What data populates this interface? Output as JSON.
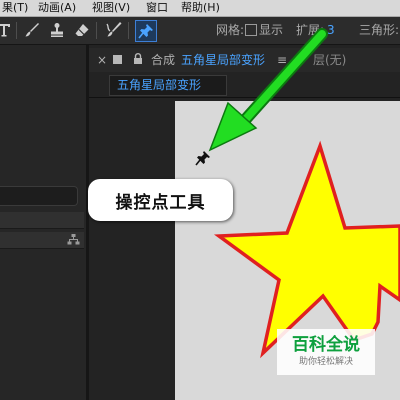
{
  "menubar": {
    "items": [
      "果(T)",
      "动画(A)",
      "视图(V)",
      "窗口",
      "帮助(H)"
    ]
  },
  "toolbar": {
    "tools": [
      "type-tool-icon",
      "brush-tool-icon",
      "clone-stamp-tool-icon",
      "eraser-tool-icon",
      "roto-brush-tool-icon",
      "puppet-pin-tool-icon"
    ],
    "selected_tool": "puppet-pin-tool-icon",
    "grid_label": "网格:",
    "show_label": "显示",
    "expand_label": "扩展:",
    "expand_value": "3",
    "triangles_label": "三角形:"
  },
  "composition_panel": {
    "close_glyph": "×",
    "panel_label": "合成",
    "comp_name": "五角星局部变形",
    "menu_glyph": "≡",
    "layer_label": "层(无)",
    "subtab_label": "五角星局部变形"
  },
  "annotation": {
    "callout_text": "操控点工具"
  },
  "watermark": {
    "title": "百科全说",
    "subtitle": "助你轻松解决"
  },
  "colors": {
    "star_fill": "#ffff00",
    "star_stroke": "#e02020",
    "arrow": "#22dd22",
    "accent_blue": "#4aa3ff",
    "canvas_bg": "#d9d9d9"
  }
}
